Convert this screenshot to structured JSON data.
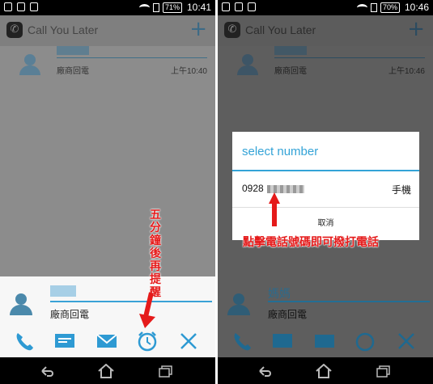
{
  "left_panel": {
    "status_time": "10:41",
    "battery": "71%",
    "app_title": "Call You Later",
    "list_item": {
      "name": "媽媽",
      "subtitle": "廠商回電",
      "time": "上午10:40"
    },
    "bottom_panel": {
      "name": "媽媽",
      "subtitle": "廠商回電"
    },
    "actions": [
      "phone-icon",
      "message-icon",
      "email-icon",
      "alarm-icon",
      "close-icon"
    ],
    "annotation": "五分鐘後再提醒"
  },
  "right_panel": {
    "status_time": "10:46",
    "battery": "70%",
    "app_title": "Call You Later",
    "list_item": {
      "name": "媽媽",
      "subtitle": "廠商回電",
      "time": "上午10:46"
    },
    "bottom_panel": {
      "name": "媽媽",
      "subtitle": "廠商回電"
    },
    "dialog": {
      "title": "select number",
      "number_prefix": "0928",
      "number_type": "手機",
      "cancel": "取消"
    },
    "annotation": "點擊電話號碼即可撥打電話"
  },
  "colors": {
    "accent": "#33a3d7",
    "annotation": "#e51a1a"
  }
}
